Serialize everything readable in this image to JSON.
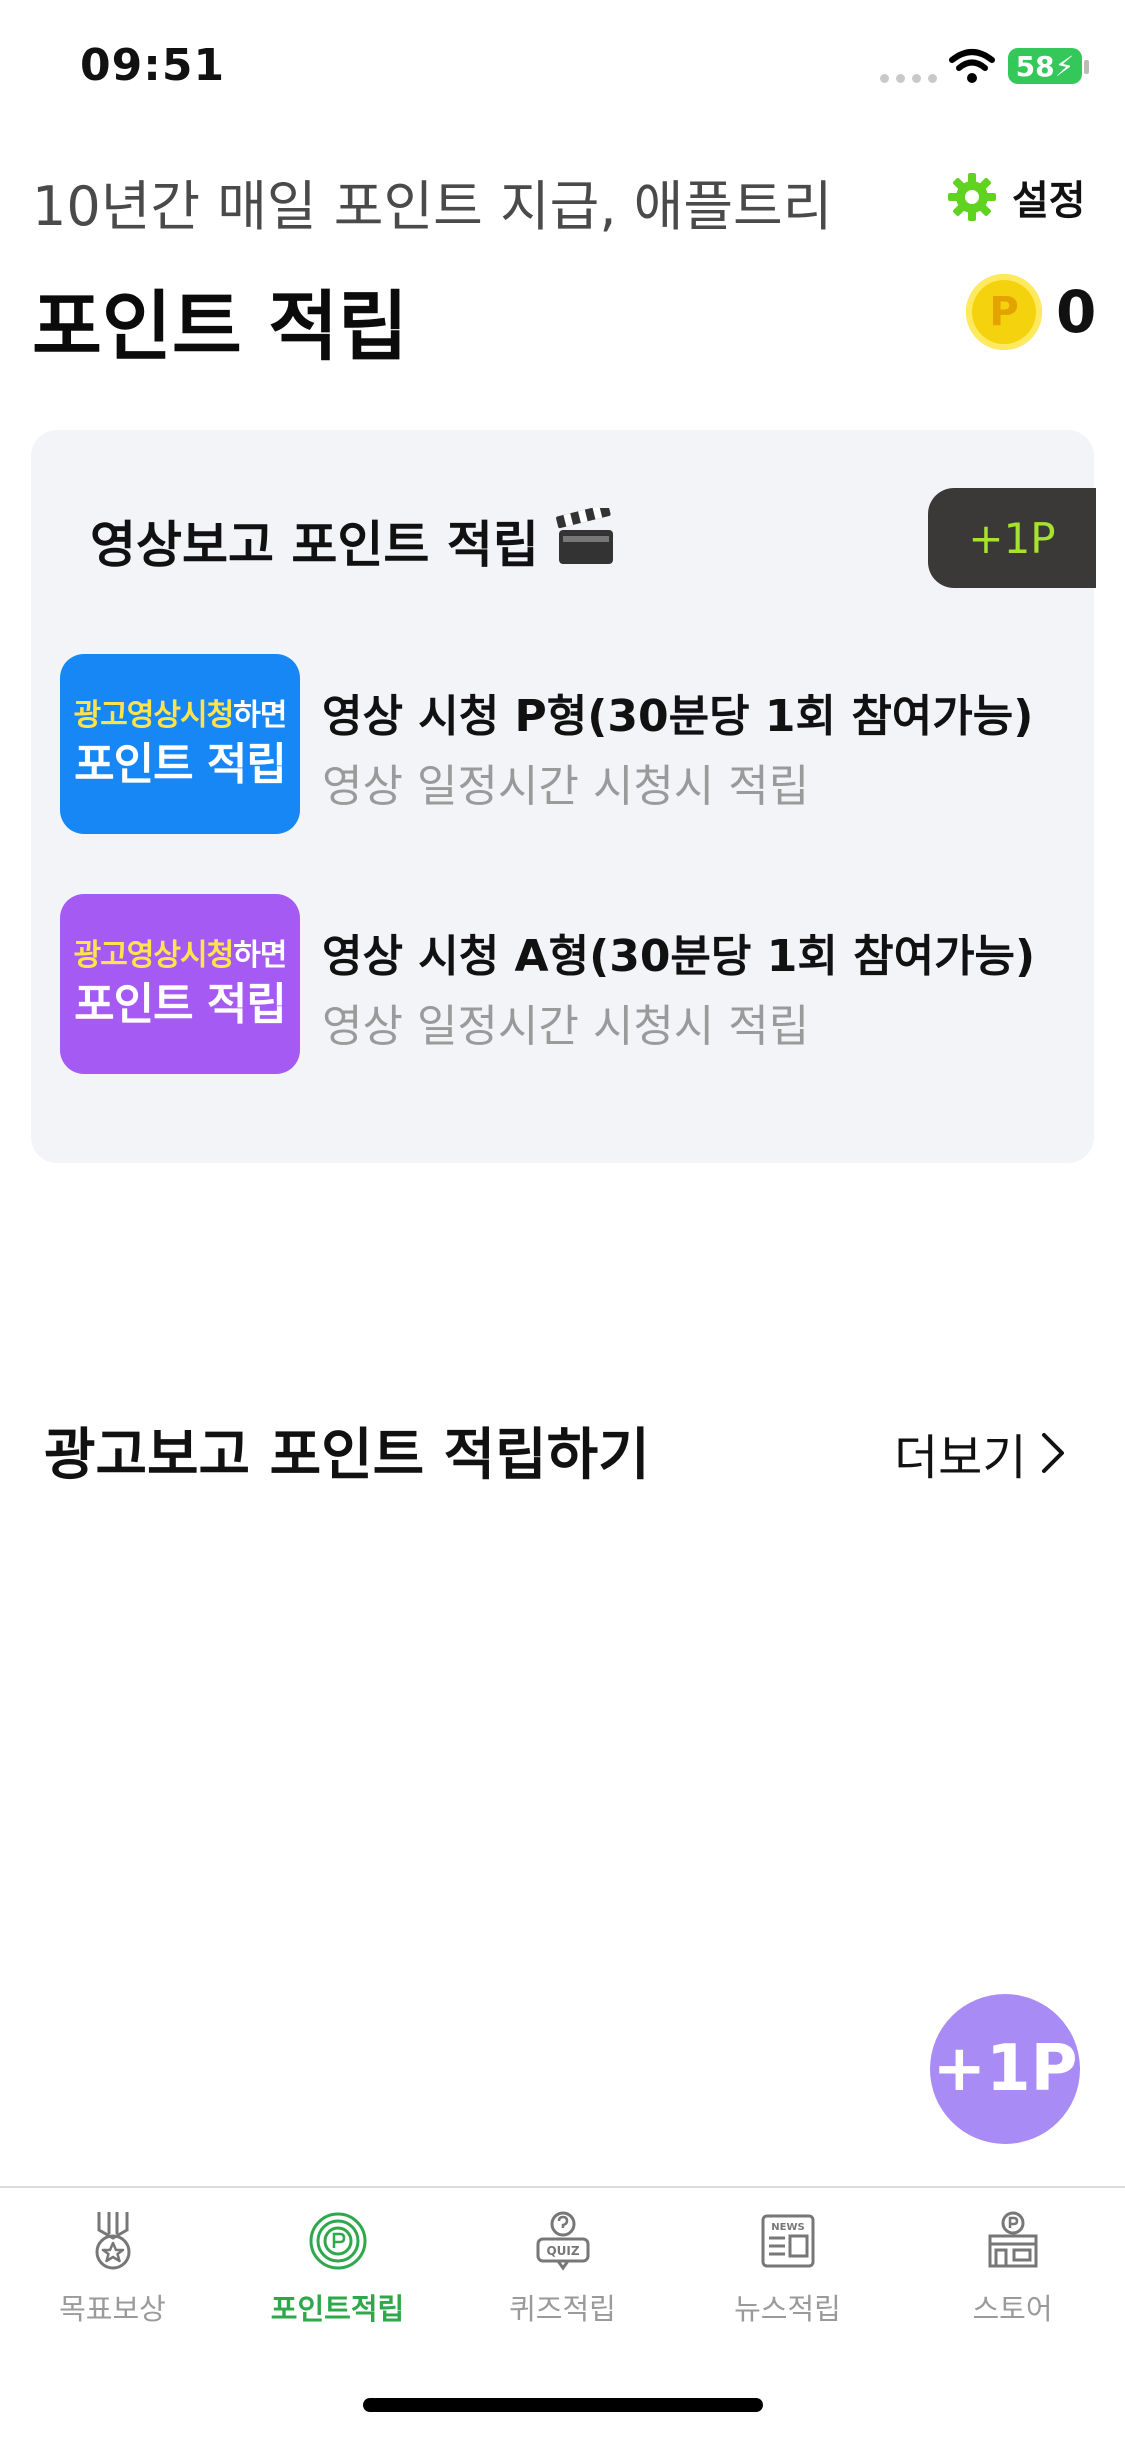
{
  "status_bar": {
    "time": "09:51",
    "battery": "58"
  },
  "header": {
    "subtitle": "10년간 매일 포인트 지급, 애플트리",
    "settings_label": "설정",
    "title": "포인트 적립",
    "coin_glyph": "P",
    "point_balance": "0"
  },
  "video_card": {
    "title": "영상보고 포인트 적립",
    "badge": "+1P",
    "items": [
      {
        "thumb_line1a": "광고영상시청",
        "thumb_line1b": "하면",
        "thumb_line2": "포인트 적립",
        "title": "영상 시청 P형(30분당 1회 참여가능)",
        "desc": "영상 일정시간 시청시 적립",
        "thumb_color": "#1687f5"
      },
      {
        "thumb_line1a": "광고영상시청",
        "thumb_line1b": "하면",
        "thumb_line2": "포인트 적립",
        "title": "영상 시청 A형(30분당 1회 참여가능)",
        "desc": "영상 일정시간 시청시 적립",
        "thumb_color": "#a45af3"
      }
    ]
  },
  "ad_section": {
    "title": "광고보고 포인트 적립하기",
    "more_label": "더보기"
  },
  "fab_label": "+1P",
  "tabs": [
    {
      "label": "목표보상",
      "icon": "medal-icon",
      "active": false
    },
    {
      "label": "포인트적립",
      "icon": "point-coin-icon",
      "active": true
    },
    {
      "label": "퀴즈적립",
      "icon": "quiz-icon",
      "active": false
    },
    {
      "label": "뉴스적립",
      "icon": "news-icon",
      "active": false
    },
    {
      "label": "스토어",
      "icon": "store-icon",
      "active": false
    }
  ],
  "colors": {
    "accent_green": "#2ea84a",
    "badge_text": "#a6e22e",
    "fab": "#a98bf5"
  }
}
